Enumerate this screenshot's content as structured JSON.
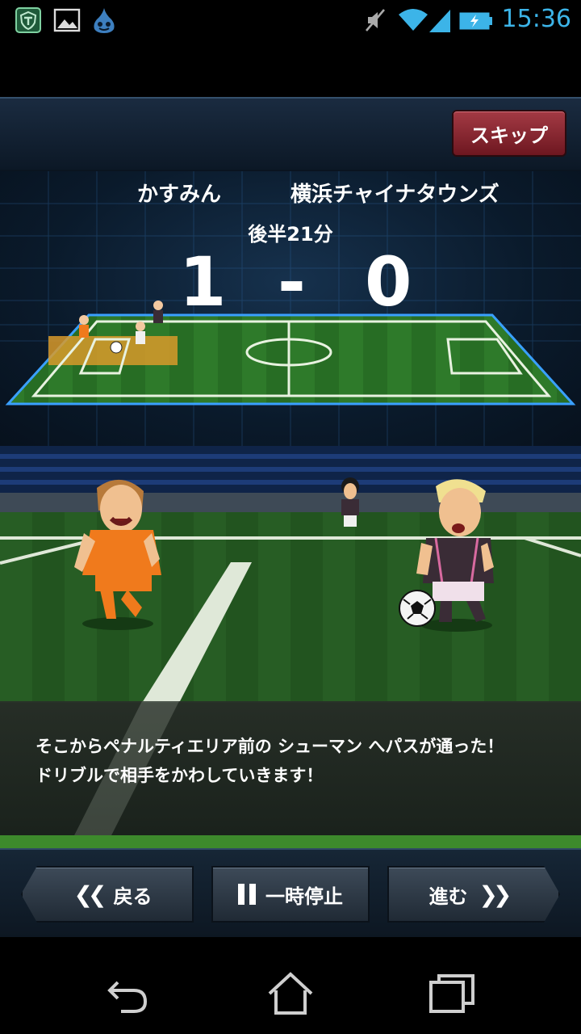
{
  "status_bar": {
    "time": "15:36",
    "left_icons": [
      "shield-app-icon",
      "image-icon",
      "slime-app-icon"
    ],
    "right_icons": [
      "mute-icon",
      "wifi-icon",
      "signal-icon",
      "battery-charging-icon"
    ]
  },
  "header": {
    "skip_label": "スキップ"
  },
  "scoreboard": {
    "home_team": "かすみん",
    "away_team": "横浜チャイナタウンズ",
    "match_time": "後半21分",
    "home_score": "1",
    "separator": "-",
    "away_score": "0"
  },
  "commentary": {
    "line1": "そこからペナルティエリア前の シューマン へパスが通った！",
    "line2": "ドリブルで相手をかわしていきます！"
  },
  "controls": {
    "back_label": "戻る",
    "pause_label": "一時停止",
    "next_label": "進む",
    "back_chevron": "❮❮",
    "next_chevron": "❯❯"
  },
  "colors": {
    "home_kit": "#f07a1c",
    "away_kit": "#3a2c36",
    "skip_button": "#8a2530",
    "time_accent": "#3cb4e8"
  },
  "navbar": {
    "icons": [
      "back-icon",
      "home-icon",
      "recent-apps-icon"
    ]
  }
}
